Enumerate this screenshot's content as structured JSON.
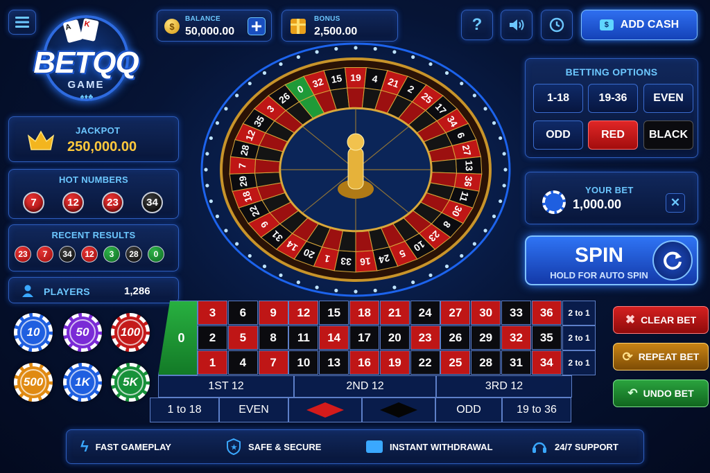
{
  "brand": {
    "name": "BETQQ",
    "sub": "GAME"
  },
  "header": {
    "balance_label": "BALANCE",
    "balance": "50,000.00",
    "bonus_label": "BONUS",
    "bonus": "2,500.00",
    "add_cash": "ADD CASH"
  },
  "jackpot": {
    "label": "JACKPOT",
    "value": "250,000.00"
  },
  "hot": {
    "label": "HOT NUMBERS",
    "numbers": [
      "7",
      "12",
      "23",
      "34"
    ]
  },
  "recent": {
    "label": "RECENT RESULTS",
    "numbers": [
      "23",
      "7",
      "34",
      "12",
      "3",
      "28",
      "0"
    ]
  },
  "players": {
    "label": "PLAYERS",
    "count": "1,286"
  },
  "chips": [
    "10",
    "50",
    "100",
    "500",
    "1K",
    "5K"
  ],
  "betting": {
    "label": "BETTING OPTIONS",
    "options": [
      "1-18",
      "19-36",
      "EVEN",
      "ODD",
      "RED",
      "BLACK"
    ]
  },
  "your_bet": {
    "label": "YOUR BET",
    "value": "1,000.00"
  },
  "spin": {
    "label": "SPIN",
    "sub": "HOLD FOR AUTO SPIN"
  },
  "actions": {
    "clear": "CLEAR BET",
    "repeat": "REPEAT BET",
    "undo": "UNDO BET"
  },
  "table": {
    "zero": "0",
    "rows": [
      [
        "3",
        "6",
        "9",
        "12",
        "15",
        "18",
        "21",
        "24",
        "27",
        "30",
        "33",
        "36"
      ],
      [
        "2",
        "5",
        "8",
        "11",
        "14",
        "17",
        "20",
        "23",
        "26",
        "29",
        "32",
        "35"
      ],
      [
        "1",
        "4",
        "7",
        "10",
        "13",
        "16",
        "19",
        "22",
        "25",
        "28",
        "31",
        "34"
      ]
    ],
    "columns": [
      "2 to 1",
      "2 to 1",
      "2 to 1"
    ],
    "dozens": [
      "1ST 12",
      "2ND 12",
      "3RD 12"
    ],
    "outside": [
      "1 to 18",
      "EVEN",
      "ODD",
      "19 to 36"
    ]
  },
  "wheel": {
    "numbers": [
      "0",
      "32",
      "15",
      "19",
      "4",
      "21",
      "2",
      "25",
      "17",
      "34",
      "6",
      "27",
      "13",
      "36",
      "11",
      "30",
      "8",
      "23",
      "10",
      "5",
      "24",
      "16",
      "33",
      "1",
      "20",
      "14",
      "31",
      "9",
      "22",
      "18",
      "29",
      "7",
      "28",
      "12",
      "35",
      "3",
      "26"
    ]
  },
  "features": [
    "FAST GAMEPLAY",
    "SAFE & SECURE",
    "INSTANT WITHDRAWAL",
    "24/7 SUPPORT"
  ],
  "colors": {
    "red": "#bf1616",
    "black": "#0b0b0f",
    "green": "#1f9a38",
    "accent": "#6cc7ff",
    "gold": "#ffc93c"
  }
}
